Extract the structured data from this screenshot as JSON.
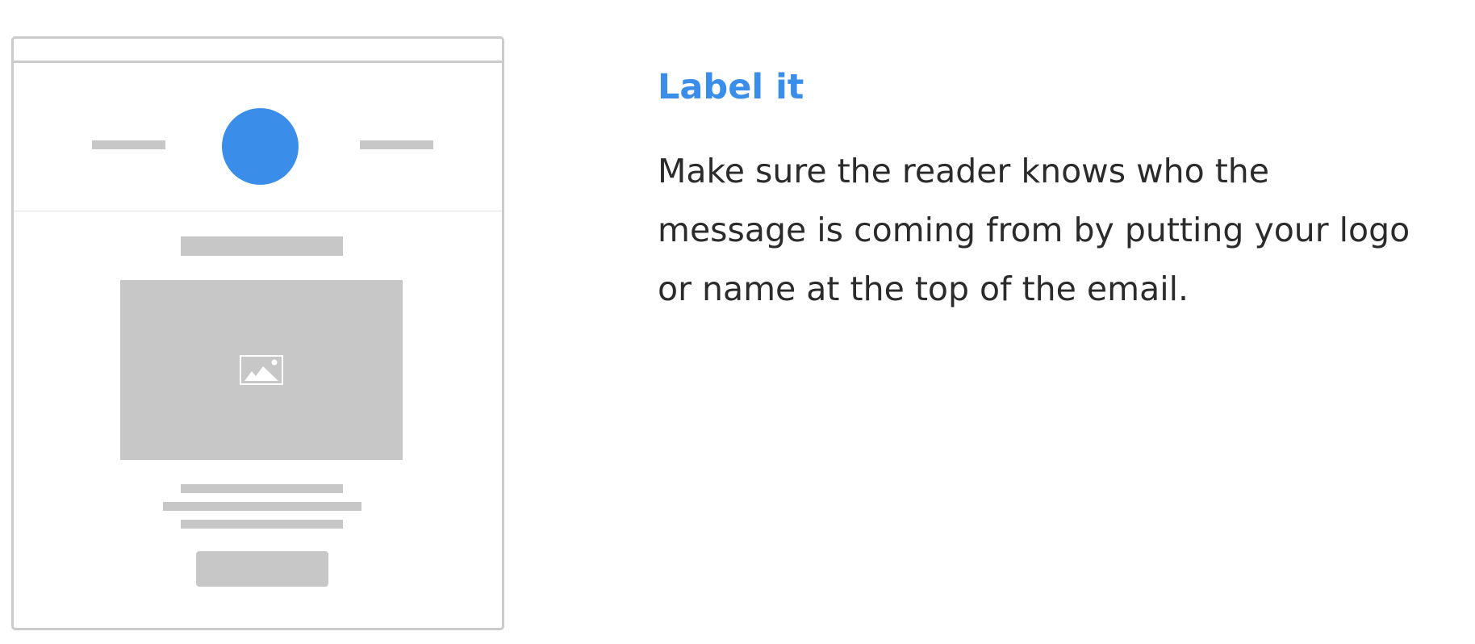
{
  "illustration": {
    "accent_color": "#3a8eea",
    "placeholder_color": "#c7c7c7",
    "border_color": "#cbcbcb",
    "image_placeholder_icon": "image-icon"
  },
  "content": {
    "heading": "Label it",
    "body_lines": [
      "Make sure the reader knows who the",
      "message is coming from by putting your logo",
      "or name at the top of the email."
    ]
  }
}
